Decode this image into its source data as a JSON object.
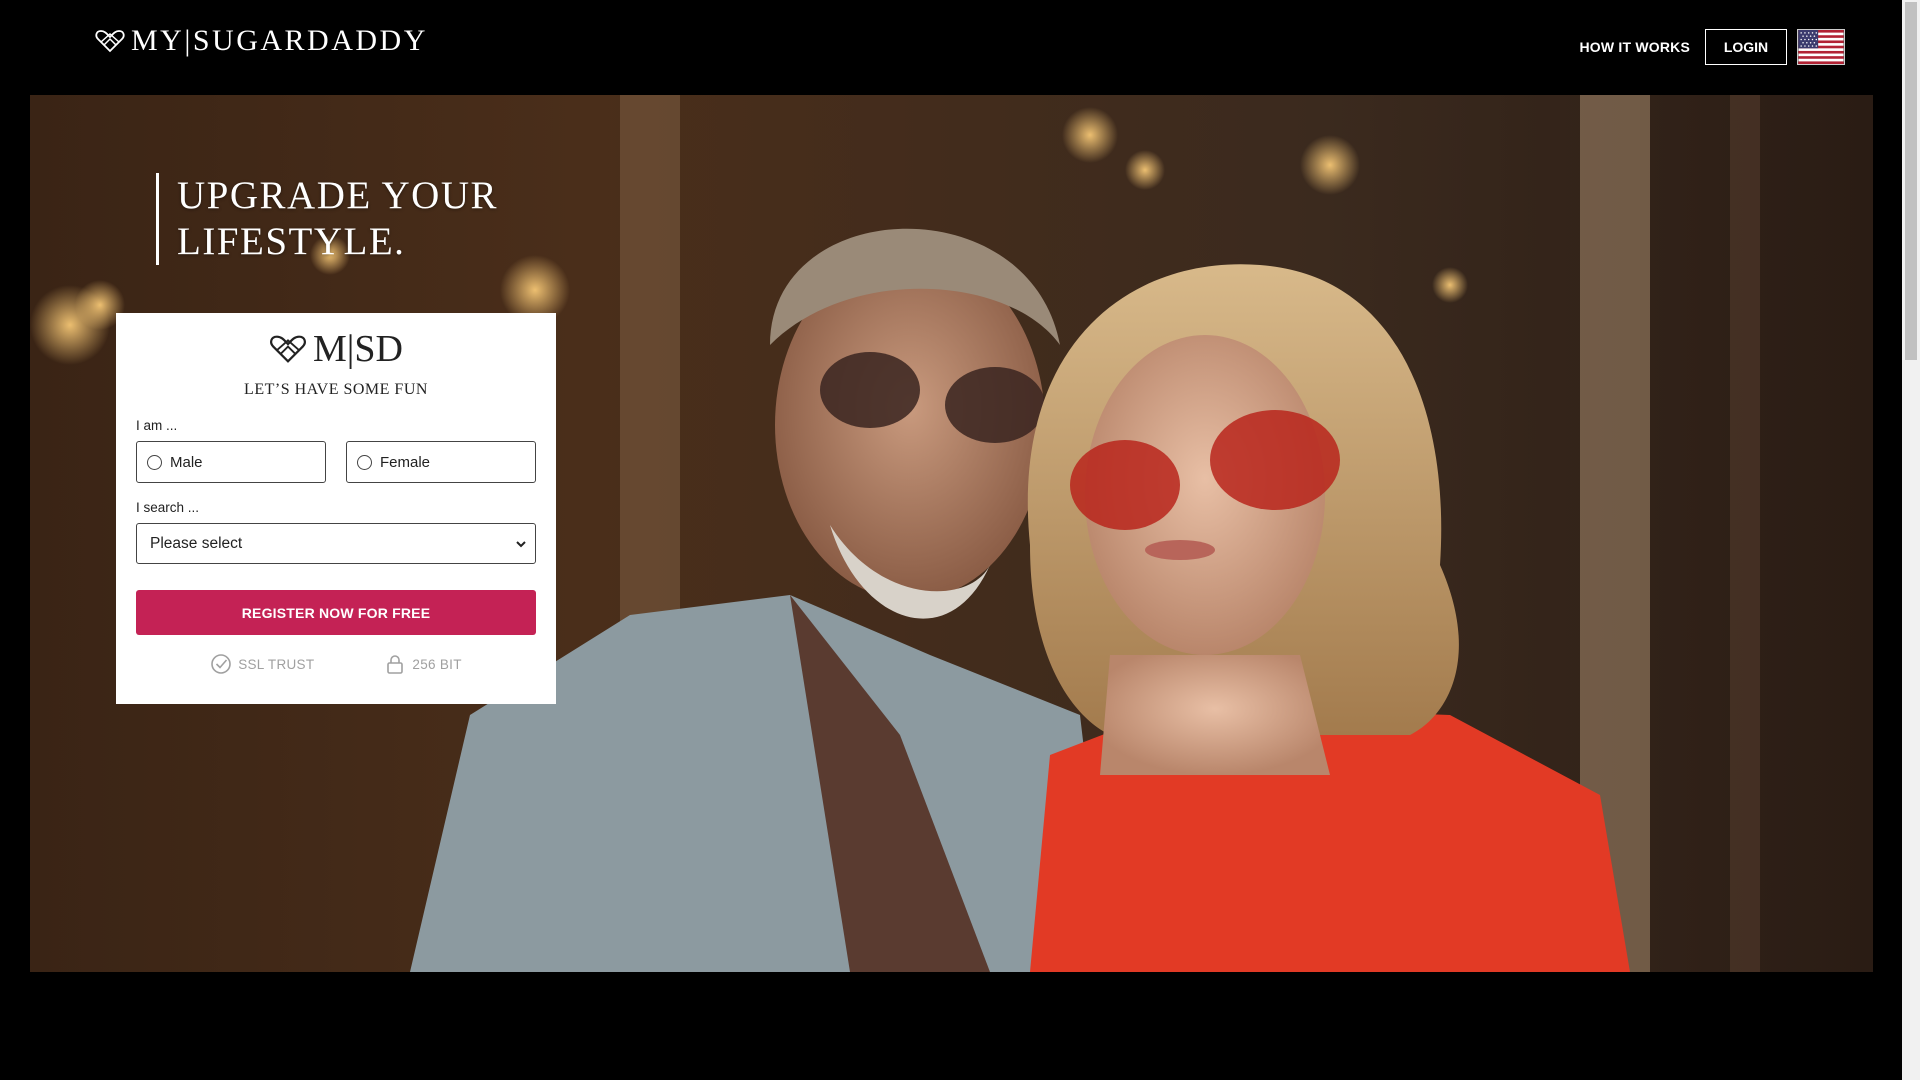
{
  "header": {
    "brand": "MY|SUGARDADDY",
    "nav_how_it_works": "HOW IT WORKS",
    "nav_login": "LOGIN",
    "language_flag": "us-flag-icon"
  },
  "hero": {
    "headline_line1": "UPGRADE YOUR",
    "headline_line2": "LIFESTYLE."
  },
  "form": {
    "card_brand": "M|SD",
    "tagline": "LET’S HAVE SOME FUN",
    "gender_label": "I am ...",
    "gender_options": [
      "Male",
      "Female"
    ],
    "search_label": "I search ...",
    "search_selected": "Please select",
    "register_label": "REGISTER NOW FOR FREE",
    "trust": {
      "ssl": "SSL TRUST",
      "bits": "256 BIT"
    }
  },
  "colors": {
    "accent": "#c42255",
    "header_bg": "#000000",
    "card_bg": "#ffffff"
  }
}
